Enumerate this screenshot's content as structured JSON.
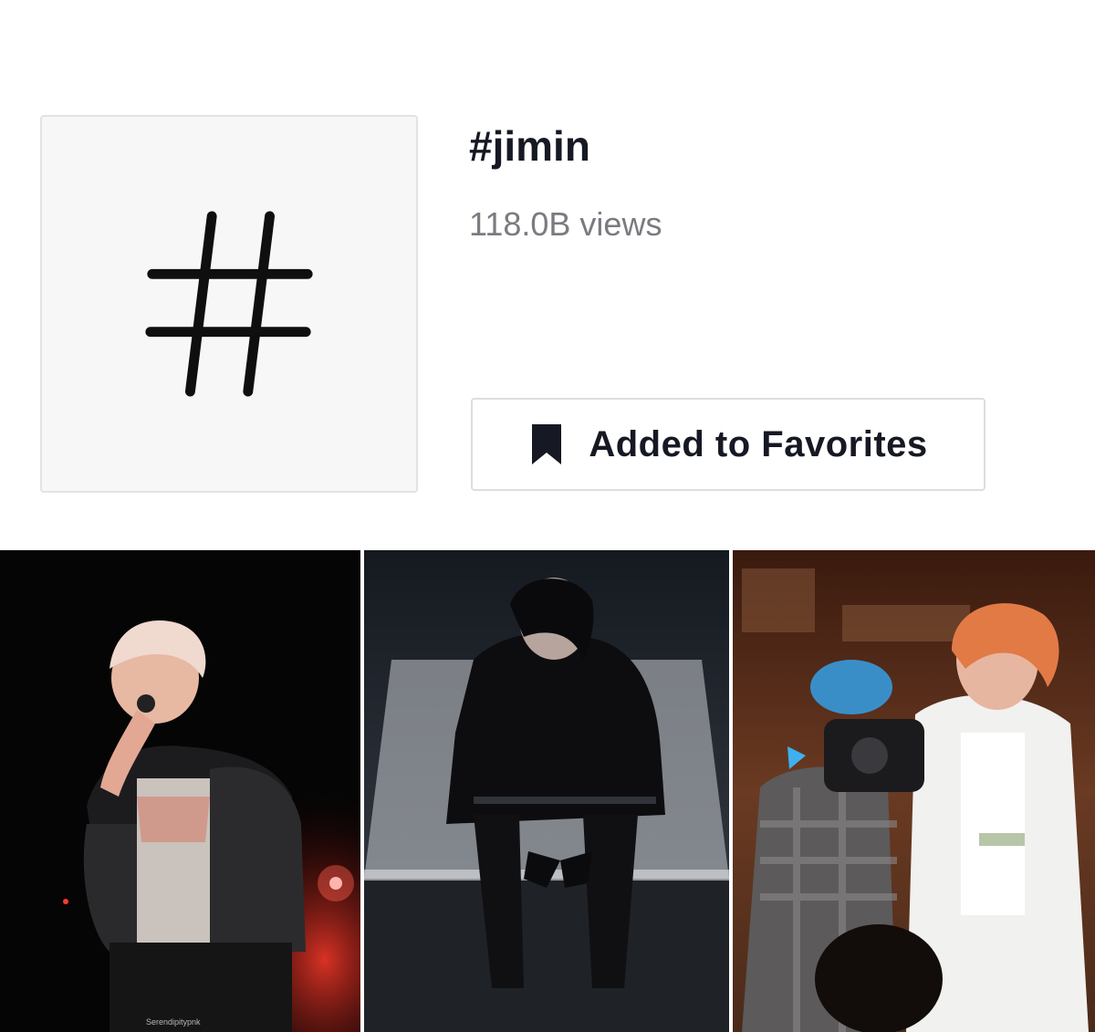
{
  "hashtag": {
    "cover_icon": "hashtag-icon",
    "title": "#jimin",
    "views": "118.0B views"
  },
  "favorite": {
    "icon": "bookmark-icon",
    "label": "Added to Favorites"
  },
  "videos": [
    {
      "thumbnail": "performer-singing-stage-red-lights",
      "watermark": "Serendipitypnk"
    },
    {
      "thumbnail": "performer-seated-dark-outfit",
      "watermark": ""
    },
    {
      "thumbnail": "performer-orange-hair-white-suit",
      "watermark": ""
    }
  ],
  "colors": {
    "text_primary": "#161823",
    "text_secondary": "#7a7b80",
    "border": "#dedede",
    "cover_bg": "#f7f7f7"
  }
}
